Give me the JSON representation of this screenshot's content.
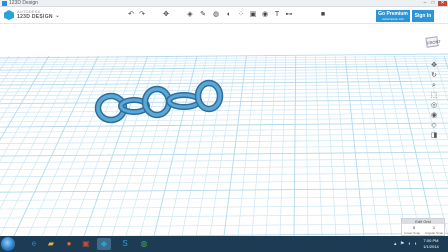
{
  "window": {
    "title": "123D Design",
    "controls": [
      "–",
      "□",
      "✕"
    ]
  },
  "app": {
    "logo_small": "AUTODESK",
    "logo_name": "123D DESIGN",
    "menu_icon": "chevron-down-icon"
  },
  "toolbar": {
    "tools": [
      {
        "icon": "undo-icon",
        "glyph": "↶"
      },
      {
        "icon": "redo-icon",
        "glyph": "↷"
      },
      {
        "icon": "transform-icon",
        "glyph": "✥"
      },
      {
        "icon": "primitives-icon",
        "glyph": "◈"
      },
      {
        "icon": "sketch-icon",
        "glyph": "✎"
      },
      {
        "icon": "construct-icon",
        "glyph": "◍"
      },
      {
        "icon": "modify-icon",
        "glyph": "◐"
      },
      {
        "icon": "pattern-icon",
        "glyph": "⁘"
      },
      {
        "icon": "grouping-icon",
        "glyph": "▣"
      },
      {
        "icon": "combine-icon",
        "glyph": "◉"
      },
      {
        "icon": "text-icon",
        "glyph": "T"
      },
      {
        "icon": "measure-icon",
        "glyph": "⊷"
      },
      {
        "icon": "material-icon",
        "glyph": "■"
      }
    ],
    "premium_label": "Go Premium",
    "premium_sub": "subscription info",
    "signin_label": "Sign In"
  },
  "viewport": {
    "model_name": "chain",
    "link_color": "#4a93c4",
    "grid_color": "#cde6f3"
  },
  "viewcube": {
    "face_label": "FRONT"
  },
  "navbar": {
    "items": [
      {
        "icon": "pan-icon",
        "glyph": "✥"
      },
      {
        "icon": "orbit-icon",
        "glyph": "↻"
      },
      {
        "icon": "zoom-icon",
        "glyph": "⌕"
      },
      {
        "icon": "fit-icon",
        "glyph": "⬚"
      },
      {
        "icon": "view-icon",
        "glyph": "◎"
      },
      {
        "icon": "visibility-icon",
        "glyph": "◉"
      },
      {
        "icon": "snap-icon",
        "glyph": "◇"
      },
      {
        "icon": "material-view-icon",
        "glyph": "◨"
      }
    ]
  },
  "grid_panel": {
    "title": "Edit Grid",
    "linear_value": "5",
    "angular_value": "1",
    "linear_label": "Linear Snap",
    "angular_label": "Angular Snap"
  },
  "taskbar": {
    "apps": [
      {
        "icon": "ie-icon",
        "glyph": "e",
        "color": "#2f84d0"
      },
      {
        "icon": "folder-icon",
        "glyph": "▰",
        "color": "#e6b44a"
      },
      {
        "icon": "firefox-icon",
        "glyph": "●",
        "color": "#e86b2c"
      },
      {
        "icon": "app-icon",
        "glyph": "▣",
        "color": "#c84a3a"
      },
      {
        "icon": "123d-icon",
        "glyph": "◆",
        "color": "#2aa0d8"
      },
      {
        "icon": "skype-icon",
        "glyph": "S",
        "color": "#2a9fe0"
      },
      {
        "icon": "chrome-icon",
        "glyph": "◍",
        "color": "#3ba552"
      }
    ],
    "time": "7:00 PM",
    "date": "1/1/2014"
  }
}
